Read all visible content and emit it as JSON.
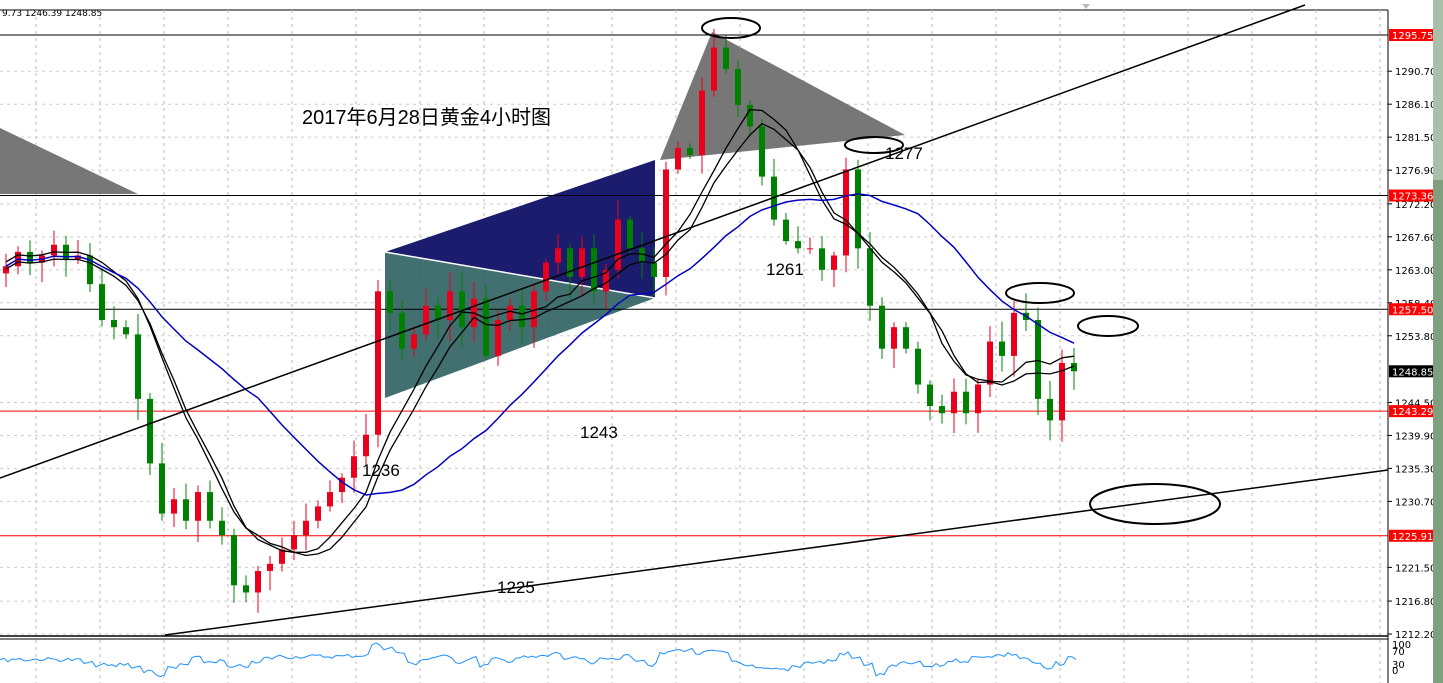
{
  "header": {
    "ohlc_text": "9.73 1246.39 1248.85"
  },
  "colors": {
    "up": "#e8001c",
    "down": "#008000",
    "ma_black": "#000000",
    "ma_blue": "#0000c0",
    "level_red": "#ff0000",
    "osc": "#1e90ff"
  },
  "chart_data": {
    "type": "candlestick",
    "title": "2017年6月28日黄金4小时图",
    "ylim": [
      1212.2,
      1298
    ],
    "y_ticks": [
      "1290.70",
      "1286.10",
      "1281.50",
      "1276.90",
      "1272.20",
      "1267.60",
      "1263.00",
      "1258.40",
      "1253.80",
      "1244.50",
      "1239.90",
      "1235.30",
      "1230.70",
      "1221.50",
      "1216.80",
      "1212.20"
    ],
    "y_tick_values": [
      1290.7,
      1286.1,
      1281.5,
      1276.9,
      1272.2,
      1267.6,
      1263.0,
      1258.4,
      1253.8,
      1244.5,
      1239.9,
      1235.3,
      1230.7,
      1221.5,
      1216.8,
      1212.2
    ],
    "price_tags": [
      {
        "label": "1295.75",
        "value": 1295.75,
        "bg": "#ff0000",
        "line": "#000000"
      },
      {
        "label": "1273.36",
        "value": 1273.36,
        "bg": "#ff0000",
        "line": "#000000"
      },
      {
        "label": "1257.50",
        "value": 1257.5,
        "bg": "#ff0000",
        "line": "#000000"
      },
      {
        "label": "1248.85",
        "value": 1248.85,
        "bg": "#000000",
        "line": null
      },
      {
        "label": "1243.29",
        "value": 1243.29,
        "bg": "#ff0000",
        "line": "#ff0000"
      },
      {
        "label": "1225.91",
        "value": 1225.91,
        "bg": "#ff0000",
        "line": "#ff0000"
      }
    ],
    "closes": [
      1263.5,
      1265.5,
      1264,
      1265,
      1266.5,
      1264.5,
      1265,
      1261,
      1256,
      1255,
      1254,
      1245,
      1236,
      1229,
      1231,
      1228,
      1232,
      1228,
      1226,
      1219,
      1218,
      1221,
      1222,
      1224,
      1226,
      1228,
      1230,
      1232,
      1234,
      1237,
      1240,
      1260,
      1257,
      1252,
      1254,
      1258,
      1256,
      1260,
      1255,
      1259,
      1251,
      1256,
      1258,
      1255,
      1260,
      1264,
      1266,
      1262,
      1266,
      1260,
      1263,
      1270,
      1266,
      1264,
      1262,
      1277,
      1280,
      1279,
      1288,
      1294,
      1291,
      1286,
      1283,
      1276,
      1270,
      1267,
      1266,
      1266,
      1263,
      1265,
      1277,
      1266,
      1258,
      1252,
      1255,
      1252,
      1247,
      1244,
      1243,
      1246,
      1243,
      1247,
      1253,
      1251,
      1257,
      1256,
      1245,
      1242,
      1250,
      1248.85
    ],
    "annotations": [
      "1277",
      "1261",
      "1243",
      "1236",
      "1225"
    ],
    "oscillator_levels": [
      "100",
      "70",
      "30",
      "0"
    ]
  }
}
